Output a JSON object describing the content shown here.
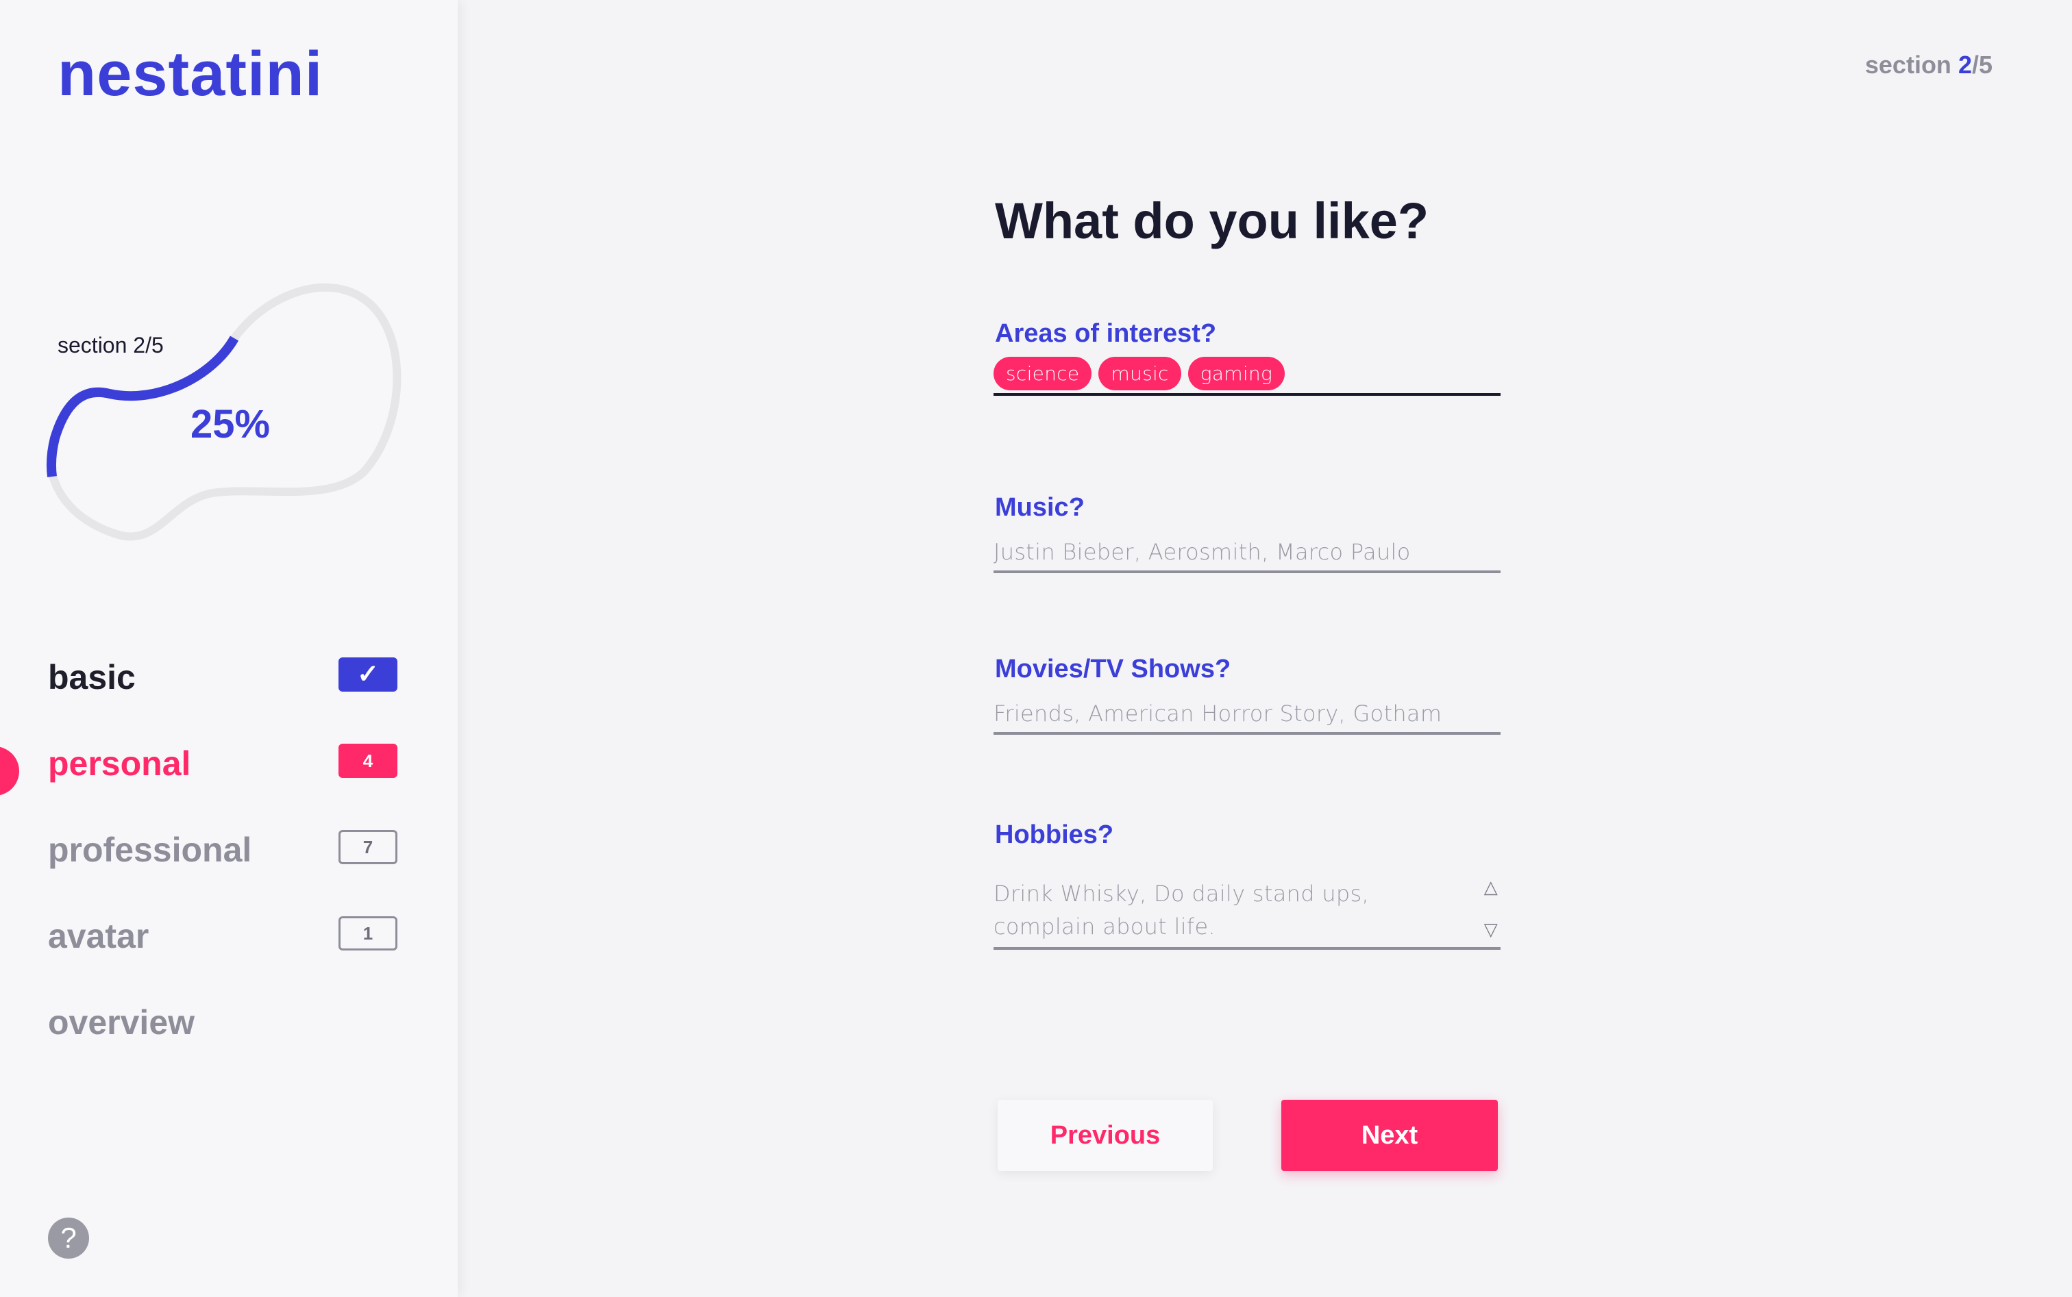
{
  "app": {
    "logo": "nestatini"
  },
  "progress": {
    "section_label": "section 2/5",
    "percent_label": "25%",
    "value": 0.25,
    "track_color": "#e6e6e9",
    "fill_color": "#3b3fd8"
  },
  "nav": {
    "items": [
      {
        "label": "basic",
        "badge": "✓",
        "state": "done"
      },
      {
        "label": "personal",
        "badge": "4",
        "state": "active"
      },
      {
        "label": "professional",
        "badge": "7",
        "state": "pending"
      },
      {
        "label": "avatar",
        "badge": "1",
        "state": "pending"
      },
      {
        "label": "overview",
        "badge": "",
        "state": "pending"
      }
    ]
  },
  "help": {
    "icon": "question-icon",
    "glyph": "?"
  },
  "header": {
    "section_prefix": "section ",
    "section_current": "2",
    "section_total": "/5"
  },
  "form": {
    "title": "What do you like?",
    "interests": {
      "label": "Areas of interest?",
      "tags": [
        "science",
        "music",
        "gaming"
      ]
    },
    "music": {
      "label": "Music?",
      "placeholder": "Justin Bieber, Aerosmith, Marco Paulo"
    },
    "movies": {
      "label": "Movies/TV Shows?",
      "placeholder": "Friends, American Horror Story, Gotham"
    },
    "hobbies": {
      "label": "Hobbies?",
      "placeholder": "Drink Whisky, Do daily stand ups, complain about life.",
      "spin_up": "△",
      "spin_down": "▽"
    }
  },
  "buttons": {
    "previous": "Previous",
    "next": "Next"
  },
  "colors": {
    "accent": "#3b3fd8",
    "brand": "#ff2869",
    "text_dark": "#1a1a2e",
    "muted": "#8e8e9a"
  }
}
